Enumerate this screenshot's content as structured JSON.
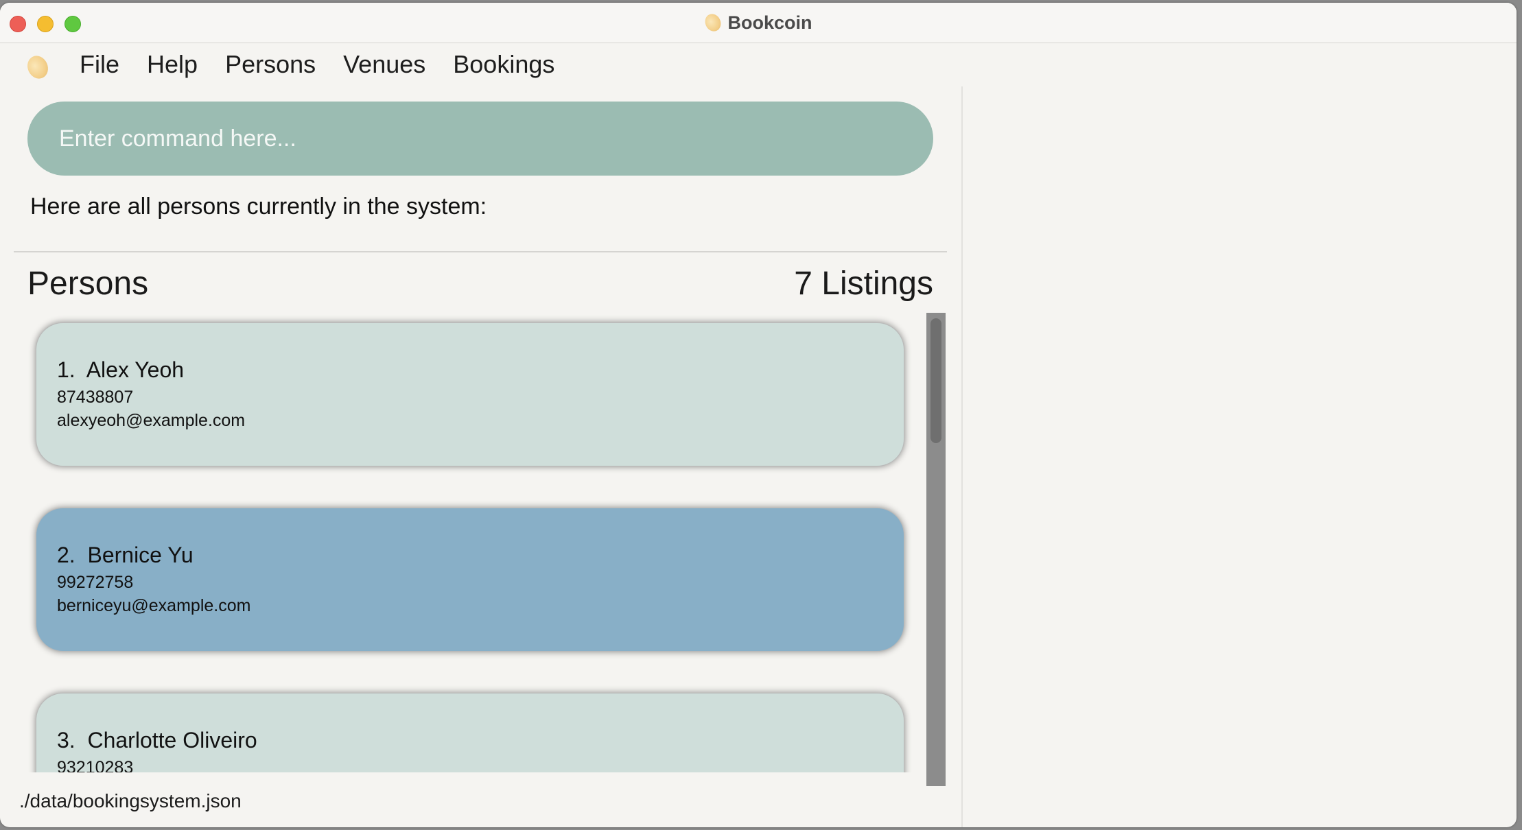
{
  "window": {
    "title": "Bookcoin"
  },
  "menu": {
    "items": [
      "File",
      "Help",
      "Persons",
      "Venues",
      "Bookings"
    ]
  },
  "command": {
    "placeholder": "Enter command here..."
  },
  "result": {
    "message": "Here are all persons currently in the system:"
  },
  "list": {
    "title": "Persons",
    "count_label": "7 Listings",
    "persons": [
      {
        "index": "1.",
        "name": "Alex Yeoh",
        "phone": "87438807",
        "email": "alexyeoh@example.com",
        "selected": false
      },
      {
        "index": "2.",
        "name": "Bernice Yu",
        "phone": "99272758",
        "email": "berniceyu@example.com",
        "selected": true
      },
      {
        "index": "3.",
        "name": "Charlotte Oliveiro",
        "phone": "93210283",
        "email": "",
        "selected": false
      }
    ]
  },
  "status": {
    "file_path": "./data/bookingsystem.json"
  },
  "colors": {
    "command_bg": "#9bbcb2",
    "card_bg": "#cfdeda",
    "card_selected_bg": "#88afc7"
  }
}
